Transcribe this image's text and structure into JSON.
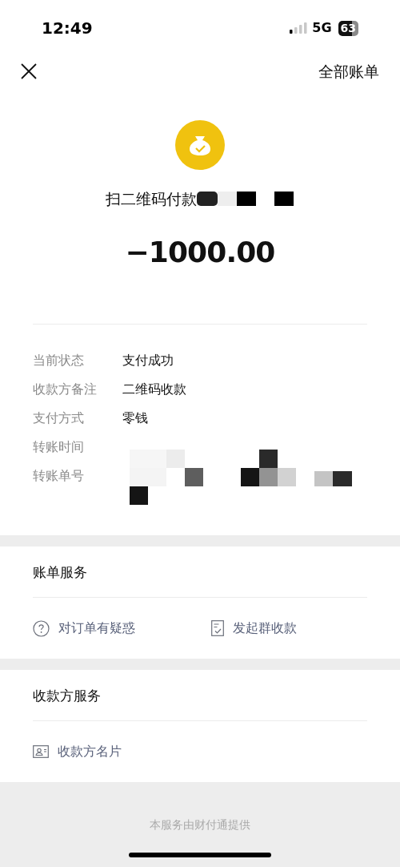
{
  "status_bar": {
    "time": "12:49",
    "network": "5G",
    "battery": "63"
  },
  "nav": {
    "right_action": "全部账单"
  },
  "payment": {
    "title": "扫二维码付款",
    "amount": "−1000.00"
  },
  "details": [
    {
      "label": "当前状态",
      "value": "支付成功"
    },
    {
      "label": "收款方备注",
      "value": "二维码收款"
    },
    {
      "label": "支付方式",
      "value": "零钱"
    },
    {
      "label": "转账时间"
    },
    {
      "label": "转账单号"
    }
  ],
  "sections": [
    {
      "title": "账单服务",
      "actions": [
        {
          "kind": "question",
          "label": "对订单有疑惑"
        },
        {
          "kind": "receipt",
          "label": "发起群收款"
        }
      ]
    },
    {
      "title": "收款方服务",
      "actions": [
        {
          "kind": "card",
          "label": "收款方名片"
        }
      ]
    }
  ],
  "footer": "本服务由财付通提供"
}
